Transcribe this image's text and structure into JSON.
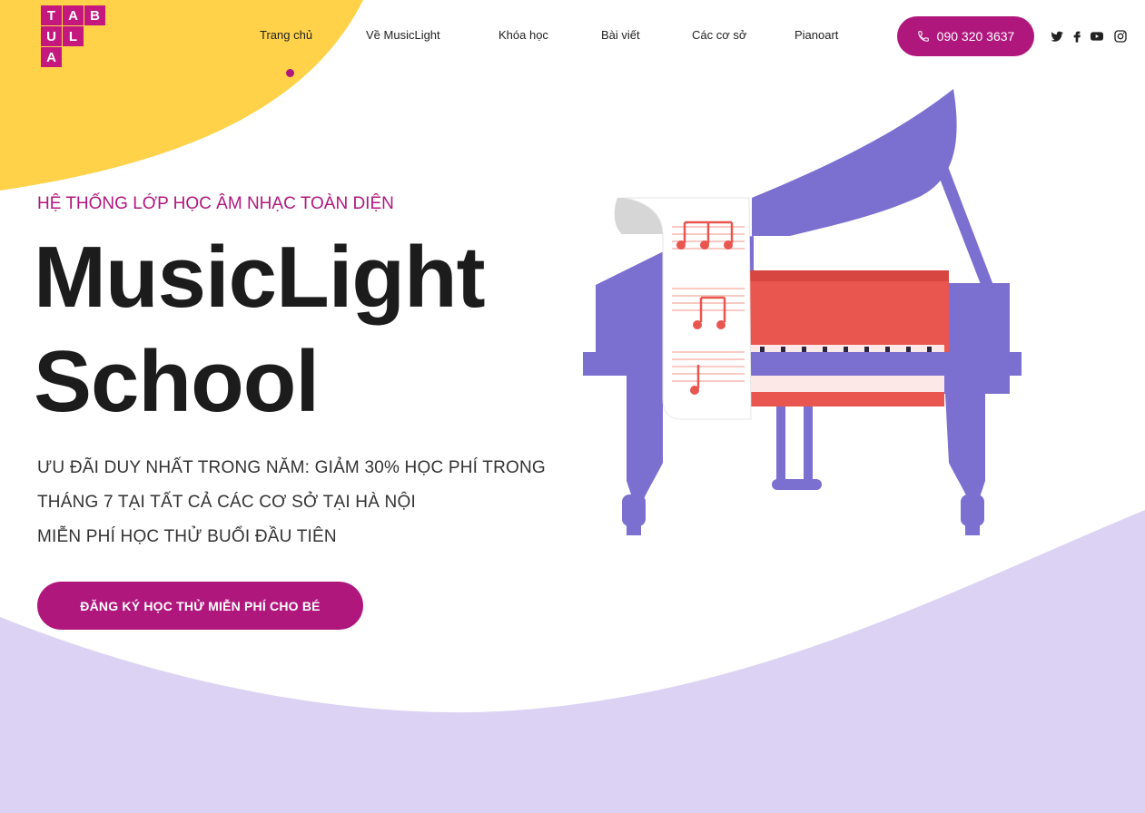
{
  "logo": {
    "letters": [
      "T",
      "A",
      "B",
      "U",
      "L",
      "A"
    ]
  },
  "nav": {
    "items": [
      "Trang chủ",
      "Về MusicLight",
      "Khóa học",
      "Bài viết",
      "Các cơ sở",
      "Pianoart"
    ],
    "active_index": 0
  },
  "phone": {
    "label": "090 320 3637",
    "icon": "phone-icon"
  },
  "social": [
    "twitter-icon",
    "facebook-icon",
    "youtube-icon",
    "instagram-icon"
  ],
  "hero": {
    "eyebrow": "HỆ THỐNG LỚP HỌC ÂM NHẠC TOÀN DIỆN",
    "title_line1": "MusicLight",
    "title_line2": "School",
    "desc_line1": "ƯU ĐÃI DUY NHẤT TRONG NĂM: GIẢM 30% HỌC PHÍ TRONG",
    "desc_line2": "THÁNG 7 TẠI TẤT CẢ CÁC CƠ SỞ TẠI HÀ NỘI",
    "desc_line3": "MIỄN PHÍ HỌC THỬ BUỔI ĐẦU TIÊN",
    "cta_label": "ĐĂNG KÝ HỌC THỬ MIỄN PHÍ CHO BÉ"
  },
  "colors": {
    "accent": "#b0177d",
    "yellow_blob": "#ffd24a",
    "lavender_wave": "#dcd2f3",
    "piano_purple": "#7b6fd0",
    "piano_red": "#e9554f"
  }
}
